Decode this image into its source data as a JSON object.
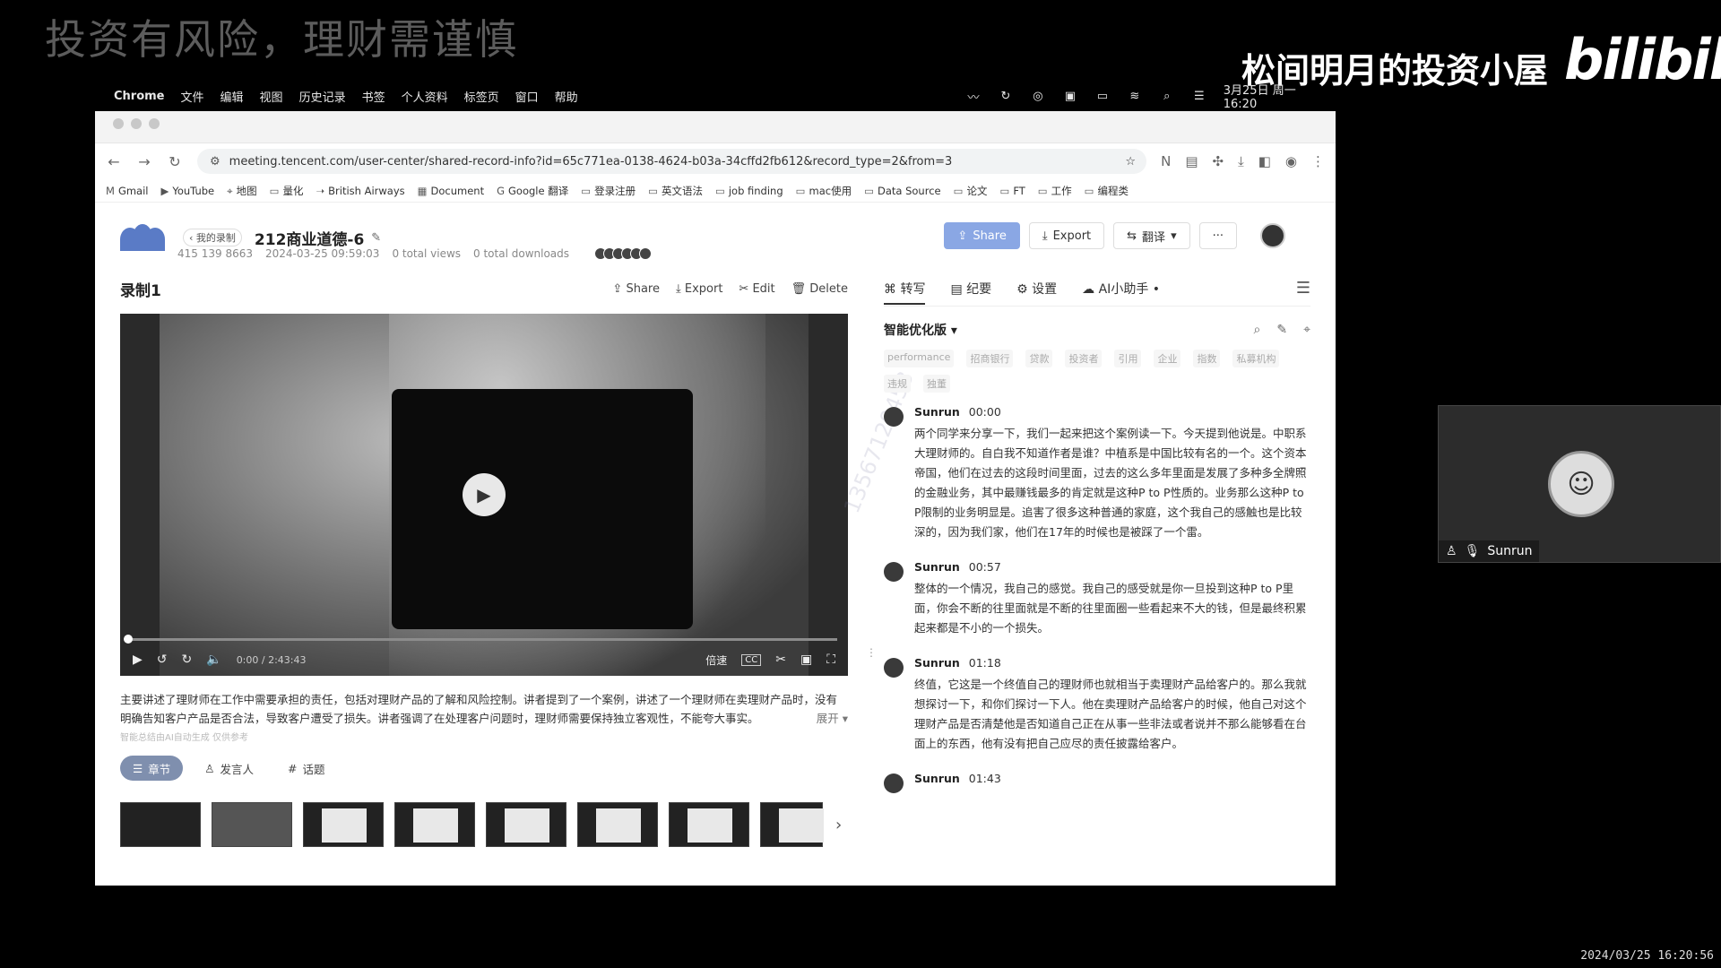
{
  "overlay": {
    "title": "投资有风险，理财需谨慎",
    "channel": "松间明月的投资小屋",
    "logo_text": "bilibili",
    "timestamp": "2024/03/25 16:20:56"
  },
  "macbar": {
    "app": "Chrome",
    "menus": [
      "文件",
      "编辑",
      "视图",
      "历史记录",
      "书签",
      "个人资料",
      "标签页",
      "窗口",
      "帮助"
    ],
    "status_icons": [
      "malware-icon",
      "sync-icon",
      "wechat-icon",
      "input-method-icon",
      "battery-icon",
      "wifi-icon",
      "search-icon",
      "control-center-icon"
    ],
    "datetime": "3月25日 周一 16:20"
  },
  "browser": {
    "url": "meeting.tencent.com/user-center/shared-record-info?id=65c771ea-0138-4624-b03a-34cffd2fb612&record_type=2&from=3",
    "bookmarks": [
      "Gmail",
      "YouTube",
      "地图",
      "量化",
      "British Airways",
      "Document",
      "Google 翻译",
      "登录注册",
      "英文语法",
      "job finding",
      "mac使用",
      "Data Source",
      "论文",
      "FT",
      "工作",
      "编程类"
    ]
  },
  "header": {
    "back": "我的录制",
    "title": "212商业道德-6",
    "meeting_id": "415 139 8663",
    "date": "2024-03-25 09:59:03",
    "views": "0 total views",
    "downloads": "0 total downloads",
    "share": "Share",
    "export": "Export",
    "translate": "翻译",
    "more": "···"
  },
  "recording": {
    "title": "录制1",
    "actions": {
      "share": "Share",
      "export": "Export",
      "edit": "Edit",
      "delete": "Delete"
    },
    "time": "0:00 / 2:43:43",
    "speed": "倍速",
    "cc": "CC",
    "progress": 0,
    "summary": "主要讲述了理财师在工作中需要承担的责任，包括对理财产品的了解和风险控制。讲者提到了一个案例，讲述了一个理财师在卖理财产品时，没有明确告知客户产品是否合法，导致客户遭受了损失。讲者强调了在处理客户问题时，理财师需要保持独立客观性，不能夸大事实。",
    "expand": "展开",
    "ai_note": "智能总结由AI自动生成 仅供参考",
    "tabs": [
      "章节",
      "发言人",
      "话题"
    ]
  },
  "transcript": {
    "tabs": [
      "转写",
      "纪要",
      "设置",
      "AI小助手"
    ],
    "version": "智能优化版",
    "keywords": [
      "performance",
      "招商银行",
      "贷款",
      "投资者",
      "引用",
      "企业",
      "指数",
      "私募机构",
      "违规",
      "独董"
    ],
    "entries": [
      {
        "speaker": "Sunrun",
        "time": "00:00",
        "text": "两个同学来分享一下，我们一起来把这个案例读一下。今天提到他说是。中职系大理财师的。自白我不知道作者是谁？中植系是中国比较有名的一个。这个资本帝国，他们在过去的这段时间里面，过去的这么多年里面是发展了多种多全牌照的金融业务，其中最赚钱最多的肯定就是这种P to P性质的。业务那么这种P to P限制的业务明显是。追害了很多这种普通的家庭，这个我自己的感触也是比较深的，因为我们家，他们在17年的时候也是被踩了一个雷。"
      },
      {
        "speaker": "Sunrun",
        "time": "00:57",
        "text": "整体的一个情况，我自己的感觉。我自己的感受就是你一旦投到这种P to P里面，你会不断的往里面就是不断的往里面圈一些看起来不大的钱，但是最终积累起来都是不小的一个损失。"
      },
      {
        "speaker": "Sunrun",
        "time": "01:18",
        "text": "终值，它这是一个终值自己的理财师也就相当于卖理财产品给客户的。那么我就想探讨一下，和你们探讨一下人。他在卖理财产品给客户的时候，他自己对这个理财产品是否清楚他是否知道自己正在从事一些非法或者说并不那么能够看在台面上的东西，他有没有把自己应尽的责任披露给客户。"
      },
      {
        "speaker": "Sunrun",
        "time": "01:43",
        "text": ""
      }
    ]
  },
  "camera": {
    "name": "Sunrun"
  }
}
